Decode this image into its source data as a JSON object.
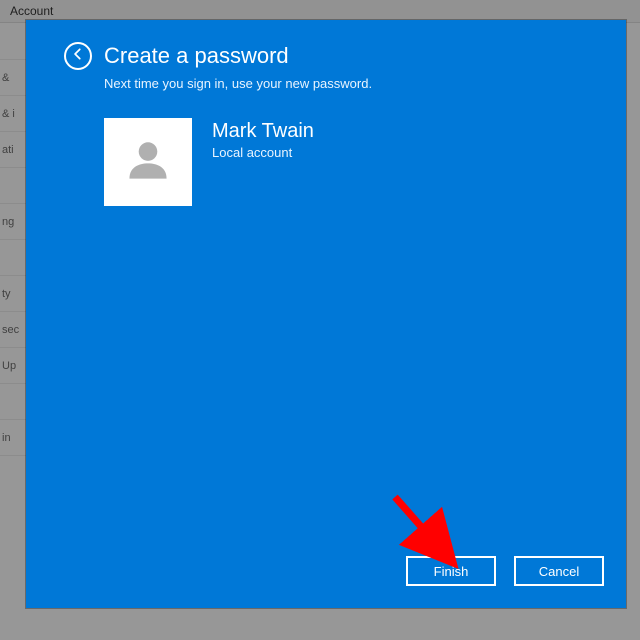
{
  "background": {
    "window_title": "Account",
    "sidebar_fragments": [
      "",
      "&",
      "& i",
      "ati",
      "",
      "ng",
      "",
      "ty",
      "sec",
      "Up",
      "",
      "in"
    ]
  },
  "dialog": {
    "title": "Create a password",
    "subtitle": "Next time you sign in, use your new password.",
    "profile": {
      "name": "Mark Twain",
      "type": "Local account"
    },
    "buttons": {
      "finish": "Finish",
      "cancel": "Cancel"
    }
  },
  "colors": {
    "accent": "#0078d7",
    "annotation": "#ff0000"
  }
}
